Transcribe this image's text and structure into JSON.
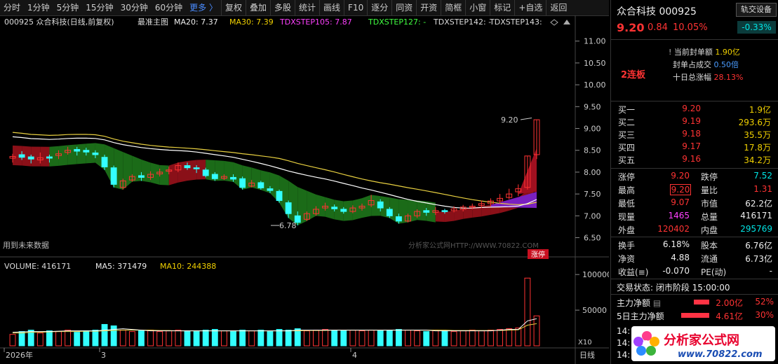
{
  "toolbar": {
    "items": [
      "分时",
      "1分钟",
      "5分钟",
      "15分钟",
      "30分钟",
      "60分钟",
      "更多 〉",
      "复权",
      "叠加",
      "多股",
      "统计",
      "画线",
      "F10",
      "逐分",
      "同资",
      "开资",
      "简框",
      "小窗",
      "标记",
      "+自选",
      "返回"
    ],
    "active_index": 6
  },
  "main_legend": {
    "code_name": "000925  众合科技(日线,前复权)",
    "main_chart": "最准主图",
    "ma20": "MA20: 7.37",
    "ma30": "MA30: 7.39",
    "step105": "TDXSTEP105: 7.87",
    "step127": "TDXSTEP127: -",
    "step142": "TDXSTEP142: -",
    "step143": "TDXSTEP143:"
  },
  "price_axis": [
    "11.00",
    "10.50",
    "10.00",
    "9.50",
    "9.00",
    "8.50",
    "8.00",
    "7.50",
    "7.00",
    "6.50"
  ],
  "annotations": {
    "high_label": "9.20",
    "low_label": "6.78",
    "future_data": "用到未来数据",
    "watermark_main": "分析家公式网HTTP://WWW.70822.COM",
    "limit_up_badge": "涨停",
    "x10": "X10",
    "period": "日线"
  },
  "vol_legend": {
    "volume": "VOLUME: 416171",
    "ma5": "MA5: 371479",
    "ma10": "MA10: 244388"
  },
  "vol_axis": [
    "100000",
    "50000"
  ],
  "date_axis": [
    {
      "label": "2026年",
      "x": "2026-01"
    },
    {
      "label": "3",
      "x": "2026-03"
    },
    {
      "label": "4",
      "x": "2026-04"
    }
  ],
  "chart_data": [
    {
      "type": "candlestick",
      "title": "",
      "ylim": [
        6.3,
        11.3
      ],
      "up_color": "#ff3333",
      "down_color": "#33ffff",
      "candles": [
        [
          8.32,
          8.36,
          8.42,
          8.22
        ],
        [
          8.4,
          8.34,
          8.48,
          8.28
        ],
        [
          8.35,
          8.3,
          8.4,
          8.2
        ],
        [
          8.28,
          8.33,
          8.45,
          8.2
        ],
        [
          8.35,
          8.32,
          8.4,
          8.22
        ],
        [
          8.38,
          8.42,
          8.5,
          8.3
        ],
        [
          8.45,
          8.5,
          8.58,
          8.4
        ],
        [
          8.52,
          8.48,
          8.58,
          8.38
        ],
        [
          8.5,
          8.46,
          8.56,
          8.38
        ],
        [
          8.44,
          8.4,
          8.5,
          8.32
        ],
        [
          8.34,
          8.12,
          8.4,
          8.05
        ],
        [
          8.1,
          7.72,
          8.15,
          7.65
        ],
        [
          7.65,
          7.8,
          7.85,
          7.6
        ],
        [
          7.82,
          7.9,
          7.95,
          7.78
        ],
        [
          7.92,
          7.88,
          8.0,
          7.8
        ],
        [
          7.88,
          7.95,
          8.02,
          7.82
        ],
        [
          7.96,
          8.0,
          8.08,
          7.9
        ],
        [
          8.02,
          8.05,
          8.12,
          7.95
        ],
        [
          8.05,
          8.15,
          8.22,
          8.0
        ],
        [
          8.15,
          8.1,
          8.22,
          8.05
        ],
        [
          8.1,
          8.08,
          8.16,
          7.98
        ],
        [
          8.05,
          7.92,
          8.1,
          7.88
        ],
        [
          7.95,
          7.85,
          8.0,
          7.8
        ],
        [
          7.86,
          7.9,
          7.95,
          7.82
        ],
        [
          7.88,
          7.84,
          7.95,
          7.78
        ],
        [
          7.85,
          7.65,
          7.9,
          7.6
        ],
        [
          7.68,
          7.75,
          7.82,
          7.65
        ],
        [
          7.76,
          7.64,
          7.8,
          7.6
        ],
        [
          7.62,
          7.58,
          7.68,
          7.52
        ],
        [
          7.56,
          7.35,
          7.6,
          7.3
        ],
        [
          7.3,
          7.05,
          7.35,
          6.95
        ],
        [
          7.0,
          6.85,
          7.1,
          6.78
        ],
        [
          6.92,
          7.05,
          7.1,
          6.88
        ],
        [
          7.05,
          7.15,
          7.22,
          7.0
        ],
        [
          7.18,
          7.22,
          7.3,
          7.12
        ],
        [
          7.2,
          7.16,
          7.26,
          7.1
        ],
        [
          7.15,
          7.1,
          7.2,
          7.05
        ],
        [
          7.1,
          7.18,
          7.24,
          7.06
        ],
        [
          7.18,
          7.22,
          7.28,
          7.12
        ],
        [
          7.25,
          7.35,
          7.48,
          7.2
        ],
        [
          7.32,
          7.18,
          7.38,
          7.1
        ],
        [
          7.15,
          7.0,
          7.2,
          6.95
        ],
        [
          6.98,
          6.88,
          7.05,
          6.82
        ],
        [
          6.88,
          7.0,
          7.05,
          6.85
        ],
        [
          7.0,
          7.1,
          7.15,
          6.95
        ],
        [
          7.12,
          7.08,
          7.18,
          7.0
        ],
        [
          7.08,
          7.12,
          7.2,
          7.02
        ],
        [
          7.12,
          7.1,
          7.16,
          7.05
        ],
        [
          7.12,
          7.16,
          7.22,
          7.08
        ],
        [
          7.15,
          7.2,
          7.25,
          7.1
        ],
        [
          7.2,
          7.22,
          7.28,
          7.15
        ],
        [
          7.24,
          7.28,
          7.35,
          7.18
        ],
        [
          7.28,
          7.34,
          7.4,
          7.22
        ],
        [
          7.34,
          7.4,
          7.5,
          7.28
        ],
        [
          7.42,
          7.5,
          7.62,
          7.38
        ],
        [
          7.55,
          7.62,
          7.72,
          7.45
        ],
        [
          7.65,
          8.37,
          8.37,
          7.6
        ],
        [
          8.4,
          9.2,
          9.2,
          8.3
        ]
      ]
    },
    {
      "type": "bar",
      "title": "",
      "ylim": [
        0,
        110000
      ],
      "values": [
        16000,
        20000,
        22000,
        18000,
        21000,
        20000,
        22000,
        19000,
        21000,
        22000,
        30000,
        28000,
        22000,
        20000,
        21000,
        22000,
        20000,
        21000,
        22000,
        21000,
        20000,
        22000,
        23000,
        21000,
        20000,
        22000,
        21000,
        22000,
        20000,
        23000,
        22000,
        24000,
        21000,
        22000,
        23000,
        22000,
        21000,
        22000,
        21000,
        22000,
        21000,
        22000,
        23000,
        22000,
        21000,
        20000,
        22000,
        21000,
        20000,
        21000,
        22000,
        21000,
        22000,
        23000,
        24000,
        25000,
        95000,
        42000
      ],
      "ma5": [
        19000,
        19500,
        20000,
        20000,
        20000,
        20500,
        21000,
        21000,
        21000,
        21000,
        22000,
        23000,
        24000,
        23000,
        22000,
        21000,
        21000,
        21000,
        21000,
        21000,
        21000,
        21000,
        21000,
        21000,
        21000,
        21000,
        21000,
        21000,
        21000,
        21000,
        21000,
        22000,
        22000,
        22000,
        22000,
        22000,
        22000,
        22000,
        22000,
        22000,
        22000,
        22000,
        22000,
        22000,
        22000,
        22000,
        21000,
        21000,
        21000,
        21000,
        21000,
        21000,
        21000,
        22000,
        23000,
        23000,
        35000,
        38000
      ],
      "ma10": [
        18000,
        18000,
        19000,
        19000,
        19500,
        20000,
        20000,
        20000,
        20500,
        20500,
        21000,
        21500,
        22000,
        22000,
        22000,
        22000,
        21500,
        21500,
        21000,
        21000,
        21000,
        21000,
        21000,
        21000,
        21000,
        21000,
        21000,
        21000,
        21000,
        21000,
        21000,
        21000,
        21500,
        21500,
        21500,
        22000,
        22000,
        22000,
        22000,
        22000,
        22000,
        22000,
        22000,
        22000,
        22000,
        22000,
        22000,
        22000,
        21500,
        21500,
        21500,
        21500,
        21500,
        21500,
        22000,
        22500,
        29000,
        31000
      ]
    }
  ],
  "right_panel": {
    "name": "众合科技",
    "code": "000925",
    "btn_settings": "轨交设备",
    "price": "9.20",
    "change": "0.84",
    "change_pct": "10.05%",
    "sector_change": "-0.33%",
    "seal_amount_label": "当前封单额",
    "seal_amount": "1.90亿",
    "seal_ratio_label": "封单占成交",
    "seal_ratio": "0.50倍",
    "ten_day_label": "十日总涨幅",
    "ten_day": "28.13%",
    "streak": "2连板",
    "bids": [
      {
        "label": "买一",
        "price": "9.20",
        "vol": "1.9亿"
      },
      {
        "label": "买二",
        "price": "9.19",
        "vol": "293.6万"
      },
      {
        "label": "买三",
        "price": "9.18",
        "vol": "35.5万"
      },
      {
        "label": "买四",
        "price": "9.17",
        "vol": "17.8万"
      },
      {
        "label": "买五",
        "price": "9.16",
        "vol": "34.2万"
      }
    ],
    "fields": [
      {
        "l1": "涨停",
        "v1": "9.20",
        "c1": "red",
        "l2": "跌停",
        "v2": "7.52",
        "c2": "green"
      },
      {
        "l1": "最高",
        "v1": "9.20",
        "c1": "red",
        "l2": "量比",
        "v2": "1.31",
        "c2": "red"
      },
      {
        "l1": "最低",
        "v1": "9.07",
        "c1": "red",
        "l2": "市值",
        "v2": "62.2亿",
        "c2": "white"
      },
      {
        "l1": "现量",
        "v1": "1465",
        "c1": "magenta",
        "l2": "总量",
        "v2": "416171",
        "c2": "white"
      },
      {
        "l1": "外盘",
        "v1": "120402",
        "c1": "red",
        "l2": "内盘",
        "v2": "295769",
        "c2": "green"
      }
    ],
    "fields2": [
      {
        "l1": "换手",
        "v1": "6.18%",
        "l2": "股本",
        "v2": "6.76亿"
      },
      {
        "l1": "净资",
        "v1": "4.88",
        "l2": "流通",
        "v2": "6.73亿"
      },
      {
        "l1": "收益(≡)",
        "v1": "-0.070",
        "l2": "PE(动)",
        "v2": "-"
      }
    ],
    "trade_state": "交易状态: 闭市阶段 15:00:00",
    "main_flow_label": "主力净额",
    "main_flow": "2.00亿",
    "main_flow_pct": "52%",
    "five_day_label": "5日主力净额",
    "five_day": "4.61亿",
    "five_day_pct": "30%",
    "time_rows": [
      "14:",
      "14:",
      "14:"
    ],
    "logo_text": "分析家公式网",
    "logo_url": "www.70822.com"
  }
}
